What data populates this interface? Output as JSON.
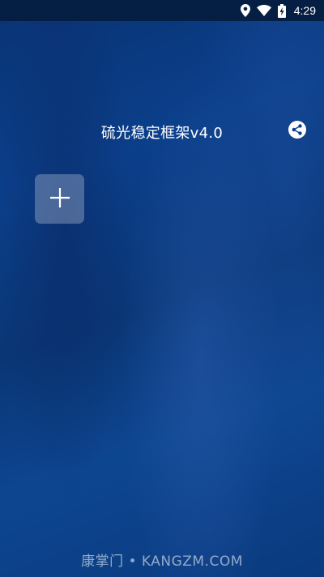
{
  "status_bar": {
    "time": "4:29",
    "icons": [
      "location-icon",
      "wifi-icon",
      "battery-charging-icon"
    ]
  },
  "header": {
    "title": "硫光稳定框架v4.0",
    "share_icon": "share-icon"
  },
  "main": {
    "add_tile_icon": "plus-icon"
  },
  "watermark": {
    "text": "康掌门 • KANGZM.COM"
  },
  "colors": {
    "background": "#0b3f8a",
    "status_bar": "#051e43",
    "text": "#ffffff"
  }
}
